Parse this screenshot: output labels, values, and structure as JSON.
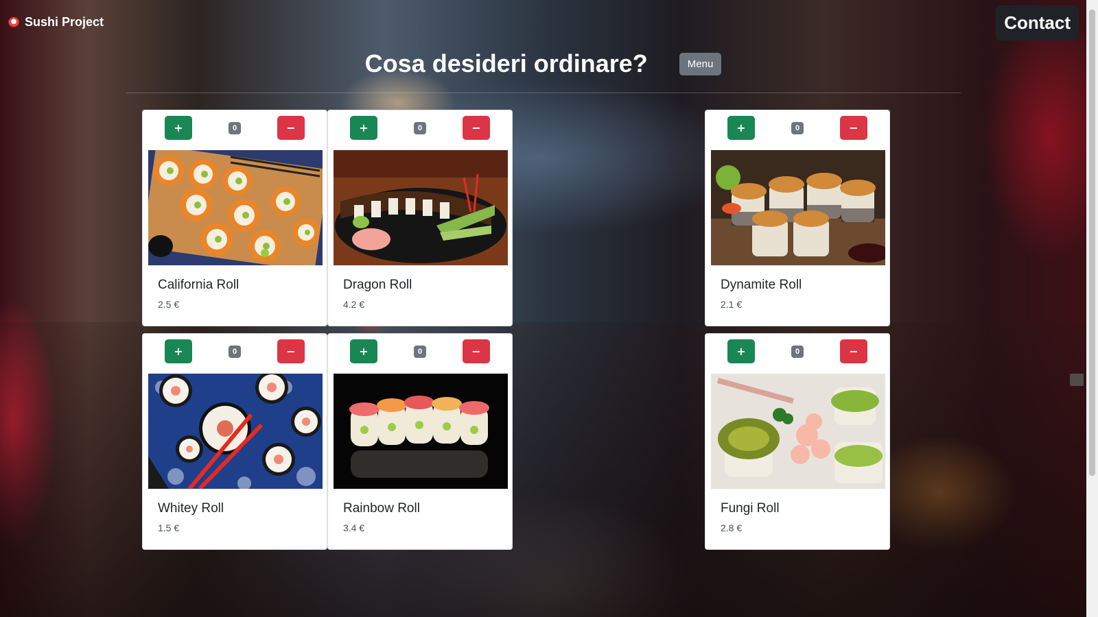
{
  "navbar": {
    "brand_label": "Sushi Project",
    "brand_icon": "sushi-icon",
    "contact_label": "Contact"
  },
  "header": {
    "title": "Cosa desideri ordinare?",
    "menu_label": "Menu"
  },
  "controls": {
    "plus_label": "+",
    "minus_label": "−"
  },
  "colors": {
    "plus": "#198754",
    "minus": "#dc3545",
    "badge": "#6c757d",
    "contact_bg": "#1f2328"
  },
  "items": [
    {
      "name": "California Roll",
      "price": "2.5 €",
      "qty": "0",
      "photo_icon": "california-roll-photo"
    },
    {
      "name": "Dragon Roll",
      "price": "4.2 €",
      "qty": "0",
      "photo_icon": "dragon-roll-photo"
    },
    {
      "name": "Dynamite Roll",
      "price": "2.1 €",
      "qty": "0",
      "photo_icon": "dynamite-roll-photo"
    },
    {
      "name": "Whitey Roll",
      "price": "1.5 €",
      "qty": "0",
      "photo_icon": "whitey-roll-photo"
    },
    {
      "name": "Rainbow Roll",
      "price": "3.4 €",
      "qty": "0",
      "photo_icon": "rainbow-roll-photo"
    },
    {
      "name": "Fungi Roll",
      "price": "2.8 €",
      "qty": "0",
      "photo_icon": "fungi-roll-photo"
    }
  ]
}
